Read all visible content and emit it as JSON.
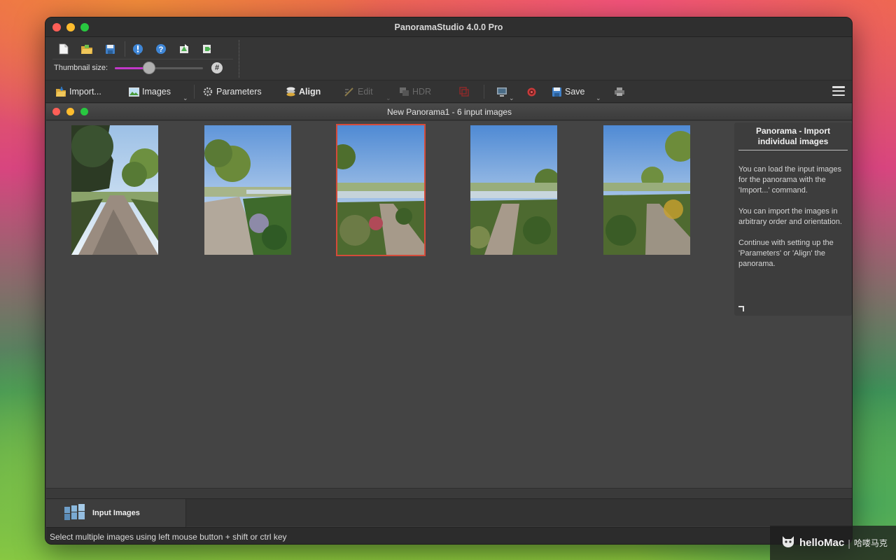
{
  "window": {
    "title": "PanoramaStudio 4.0.0 Pro"
  },
  "upper_toolbar": {
    "icons": [
      "new-document-icon",
      "open-folder-icon",
      "save-disk-icon",
      "info-icon",
      "help-icon",
      "export-icon",
      "share-icon"
    ],
    "thumbnail_label": "Thumbnail size:",
    "thumbnail_size_fraction": 0.37,
    "hash_label": "#"
  },
  "main_toolbar": {
    "import": "Import...",
    "images": "Images",
    "parameters": "Parameters",
    "align": "Align",
    "edit": "Edit",
    "hdr": "HDR",
    "save": "Save"
  },
  "document": {
    "title": "New Panorama1 - 6 input images",
    "selected_index": 2
  },
  "help_panel": {
    "title": "Panorama - Import individual images",
    "paragraphs": [
      "You can load the input images for the panorama with the 'Import...' command.",
      "You can import the images in arbitrary order and orientation.",
      "Continue with setting up the 'Parameters' or 'Align' the panorama."
    ]
  },
  "tabs": {
    "input_images": "Input Images"
  },
  "status": {
    "text": "Select multiple images using left mouse button + shift or ctrl key"
  },
  "watermark": {
    "brand": "helloMac",
    "cn": "哈喽马克"
  },
  "colors": {
    "accent_slider": "#c238c9",
    "selection_border": "#d44b3a"
  }
}
